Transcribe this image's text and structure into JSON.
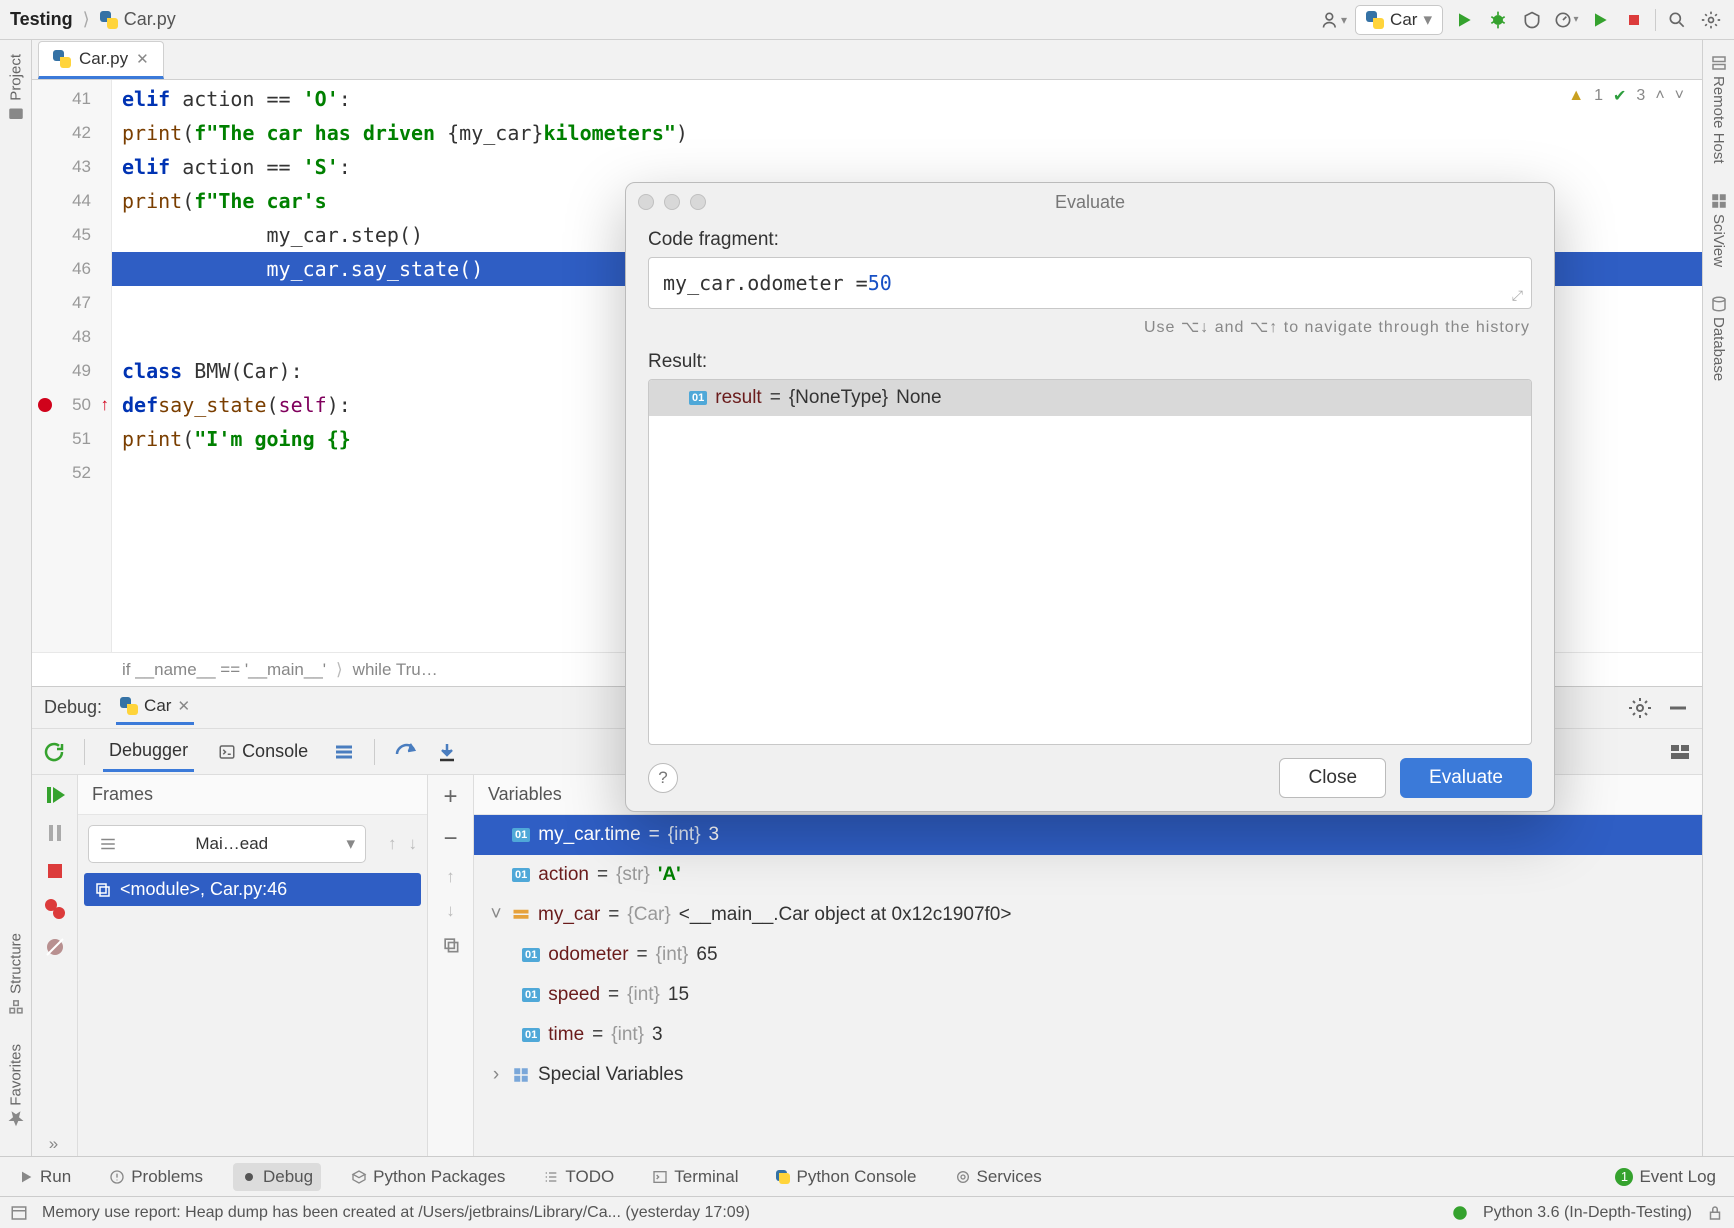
{
  "breadcrumb": {
    "project": "Testing",
    "file": "Car.py"
  },
  "run_config": "Car",
  "editor_tab": "Car.py",
  "badges": {
    "warn_count": "1",
    "ok_count": "3"
  },
  "gutter": [
    "41",
    "42",
    "43",
    "44",
    "45",
    "46",
    "47",
    "48",
    "49",
    "50",
    "51",
    "52"
  ],
  "editor_crumbs": {
    "c1": "if __name__ == '__main__'",
    "c2": "while Tru…"
  },
  "left_strip": {
    "project": "Project",
    "structure": "Structure",
    "favorites": "Favorites"
  },
  "right_strip": {
    "remote": "Remote Host",
    "sciview": "SciView",
    "database": "Database"
  },
  "debug": {
    "title": "Debug:",
    "tab": "Car",
    "sub_tabs": {
      "debugger": "Debugger",
      "console": "Console"
    },
    "frames_header": "Frames",
    "thread": "Mai…ead",
    "frame": "<module>, Car.py:46",
    "vars_header": "Variables",
    "vars": {
      "watch": {
        "name": "my_car.time",
        "type": "{int}",
        "val": "3"
      },
      "action": {
        "name": "action",
        "type": "{str}",
        "val": "'A'"
      },
      "mycar": {
        "name": "my_car",
        "type": "{Car}",
        "val": "<__main__.Car object at 0x12c1907f0>"
      },
      "odo": {
        "name": "odometer",
        "type": "{int}",
        "val": "65"
      },
      "speed": {
        "name": "speed",
        "type": "{int}",
        "val": "15"
      },
      "time": {
        "name": "time",
        "type": "{int}",
        "val": "3"
      },
      "special": "Special Variables"
    }
  },
  "dialog": {
    "title": "Evaluate",
    "code_fragment_label": "Code fragment:",
    "code_fragment_value_lhs": "my_car.odometer = ",
    "code_fragment_value_rhs": "50",
    "hint": "Use ⌥↓ and ⌥↑ to navigate through the history",
    "result_label": "Result:",
    "result_name": "result",
    "result_type": "{NoneType}",
    "result_val": "None",
    "close": "Close",
    "evaluate": "Evaluate"
  },
  "bottom_tabs": {
    "run": "Run",
    "problems": "Problems",
    "debug": "Debug",
    "packages": "Python Packages",
    "todo": "TODO",
    "terminal": "Terminal",
    "console": "Python Console",
    "services": "Services",
    "event_log": "Event Log"
  },
  "status": {
    "msg": "Memory use report: Heap dump has been created at /Users/jetbrains/Library/Ca... (yesterday 17:09)",
    "interpreter": "Python 3.6 (In-Depth-Testing)"
  }
}
